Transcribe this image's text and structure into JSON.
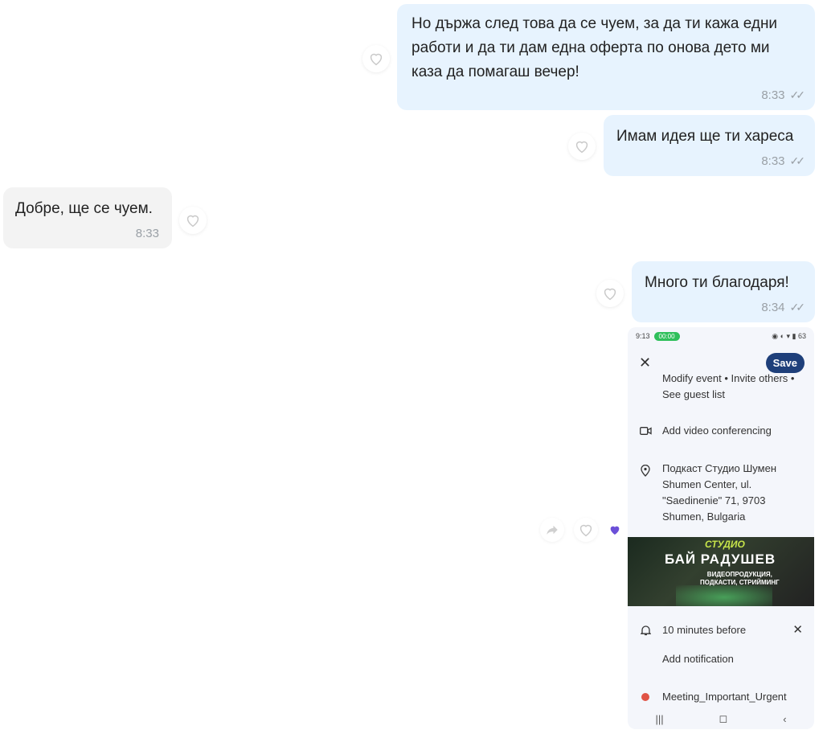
{
  "messages": [
    {
      "text": "Но държа след това да се чуем, за да ти кажа едни\nработи и да ти дам една оферта по онова дето ми\nказа да помагаш вечер!",
      "time": "8:33",
      "ticks": "✓✓"
    },
    {
      "text": "Имам идея ще ти хареса",
      "time": "8:33",
      "ticks": "✓✓"
    },
    {
      "text": "Добре, ще се чуем.",
      "time": "8:33"
    },
    {
      "text": "Много ти благодаря!",
      "time": "8:34",
      "ticks": "✓✓"
    }
  ],
  "icons": {
    "heart": "heart-icon",
    "forward": "forward-icon",
    "reaction": "purple-heart-icon"
  },
  "colors": {
    "outgoing_bubble": "#e7f3fe",
    "incoming_bubble": "#f3f3f3",
    "reaction": "#6b4fd8",
    "save_button": "#1e3f7a"
  },
  "phone": {
    "status": {
      "time": "9:13",
      "call": "00:00",
      "right": "◉ ◐ ▾ ▮ 63"
    },
    "close": "✕",
    "save": "Save",
    "rows": {
      "guests": "Modify event • Invite others •\nSee guest list",
      "video": "Add video conferencing",
      "location": "Подкаст Студио Шумен\nShumen Center, ul.\n\"Saedinenie\" 71, 9703\nShumen, Bulgaria",
      "notification": "10 minutes before",
      "add_notification": "Add notification",
      "calendar": "Meeting_Important_Urgent"
    },
    "promo": {
      "top": "СТУДИО",
      "main": "БАЙ РАДУШЕВ",
      "sub": "ВИДЕОПРОДУКЦИЯ,\nПОДКАСТИ, СТРИЙМИНГ"
    },
    "nav": [
      "|||",
      "◻",
      "‹"
    ]
  }
}
